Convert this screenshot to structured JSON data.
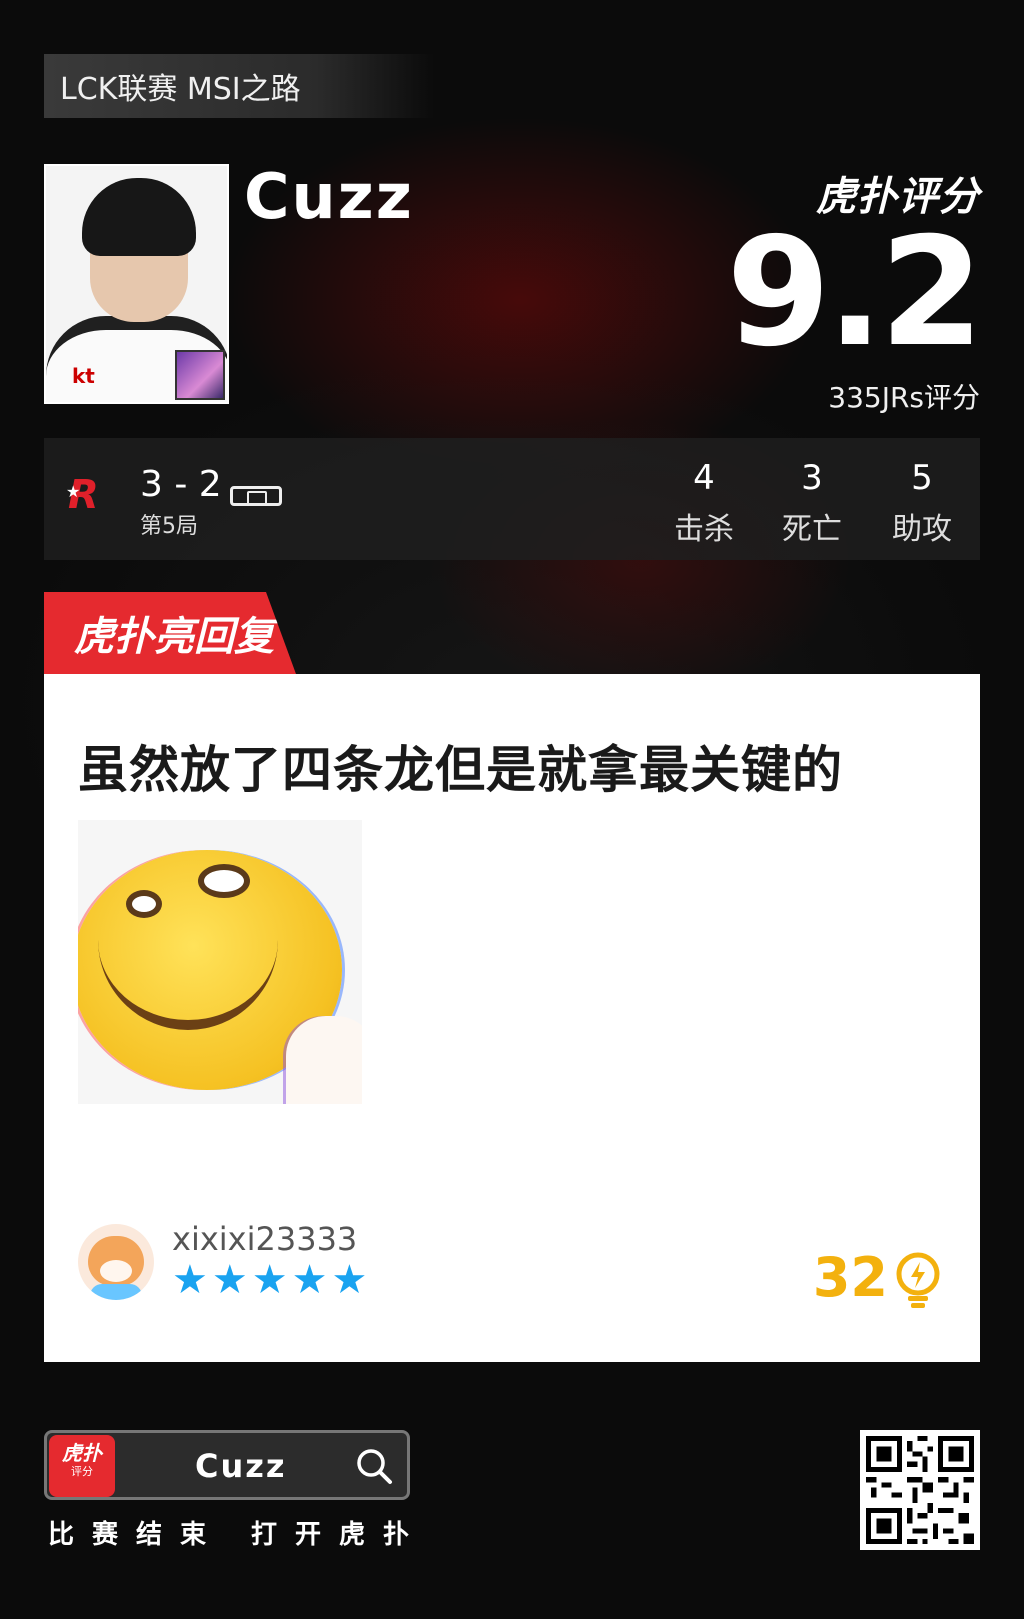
{
  "header": {
    "tag": "LCK联赛 MSI之路"
  },
  "player": {
    "name": "Cuzz",
    "photo_text": "kt"
  },
  "rating": {
    "brand": "虎扑评分",
    "score": "9.2",
    "count_label": "335JRs评分"
  },
  "match": {
    "series_score": "3 - 2",
    "game_label": "第5局",
    "stats": [
      {
        "value": "4",
        "label": "击杀"
      },
      {
        "value": "3",
        "label": "死亡"
      },
      {
        "value": "5",
        "label": "助攻"
      }
    ]
  },
  "comment": {
    "tab_label": "虎扑亮回复",
    "text": "虽然放了四条龙但是就拿最关键的",
    "username": "xixixi23333",
    "stars": "★★★★★",
    "likes": "32"
  },
  "footer": {
    "app_logo": "虎扑",
    "app_logo_sub": "评分",
    "search_text": "Cuzz",
    "caption": "比赛结束 打开虎扑"
  },
  "colors": {
    "accent_red": "#e52a2f",
    "star_blue": "#1aa3f0",
    "like_yellow": "#f3b10e"
  },
  "icons": {
    "search": "search-icon",
    "like": "lightbulb-icon",
    "battery": "battery-icon"
  }
}
